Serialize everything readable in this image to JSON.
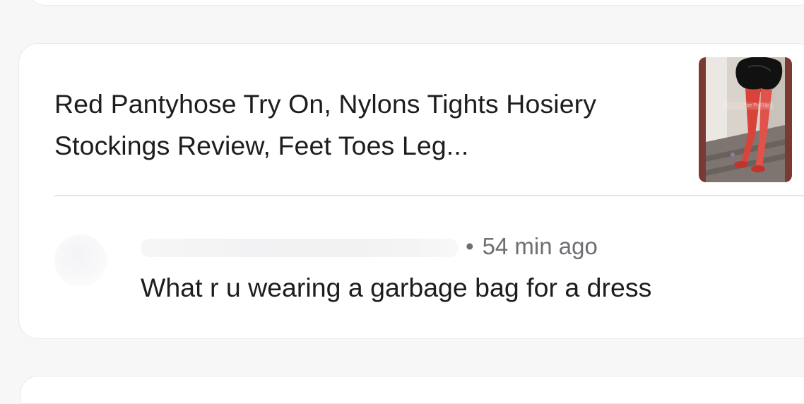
{
  "notification": {
    "video_title": "Red Pantyhose Try On, Nylons Tights Hosiery Stockings Review, Feet Toes Leg...",
    "thumbnail_caption": "Pantyhose Pull Up",
    "comment": {
      "separator": "•",
      "time_ago": "54 min ago",
      "text": "What r u wearing a garbage bag for a dress"
    }
  },
  "colors": {
    "background": "#f7f7f8",
    "card": "#ffffff",
    "primary_text": "#1d1d1f",
    "secondary_text": "#6e6e73",
    "divider": "#e6e6e8"
  }
}
